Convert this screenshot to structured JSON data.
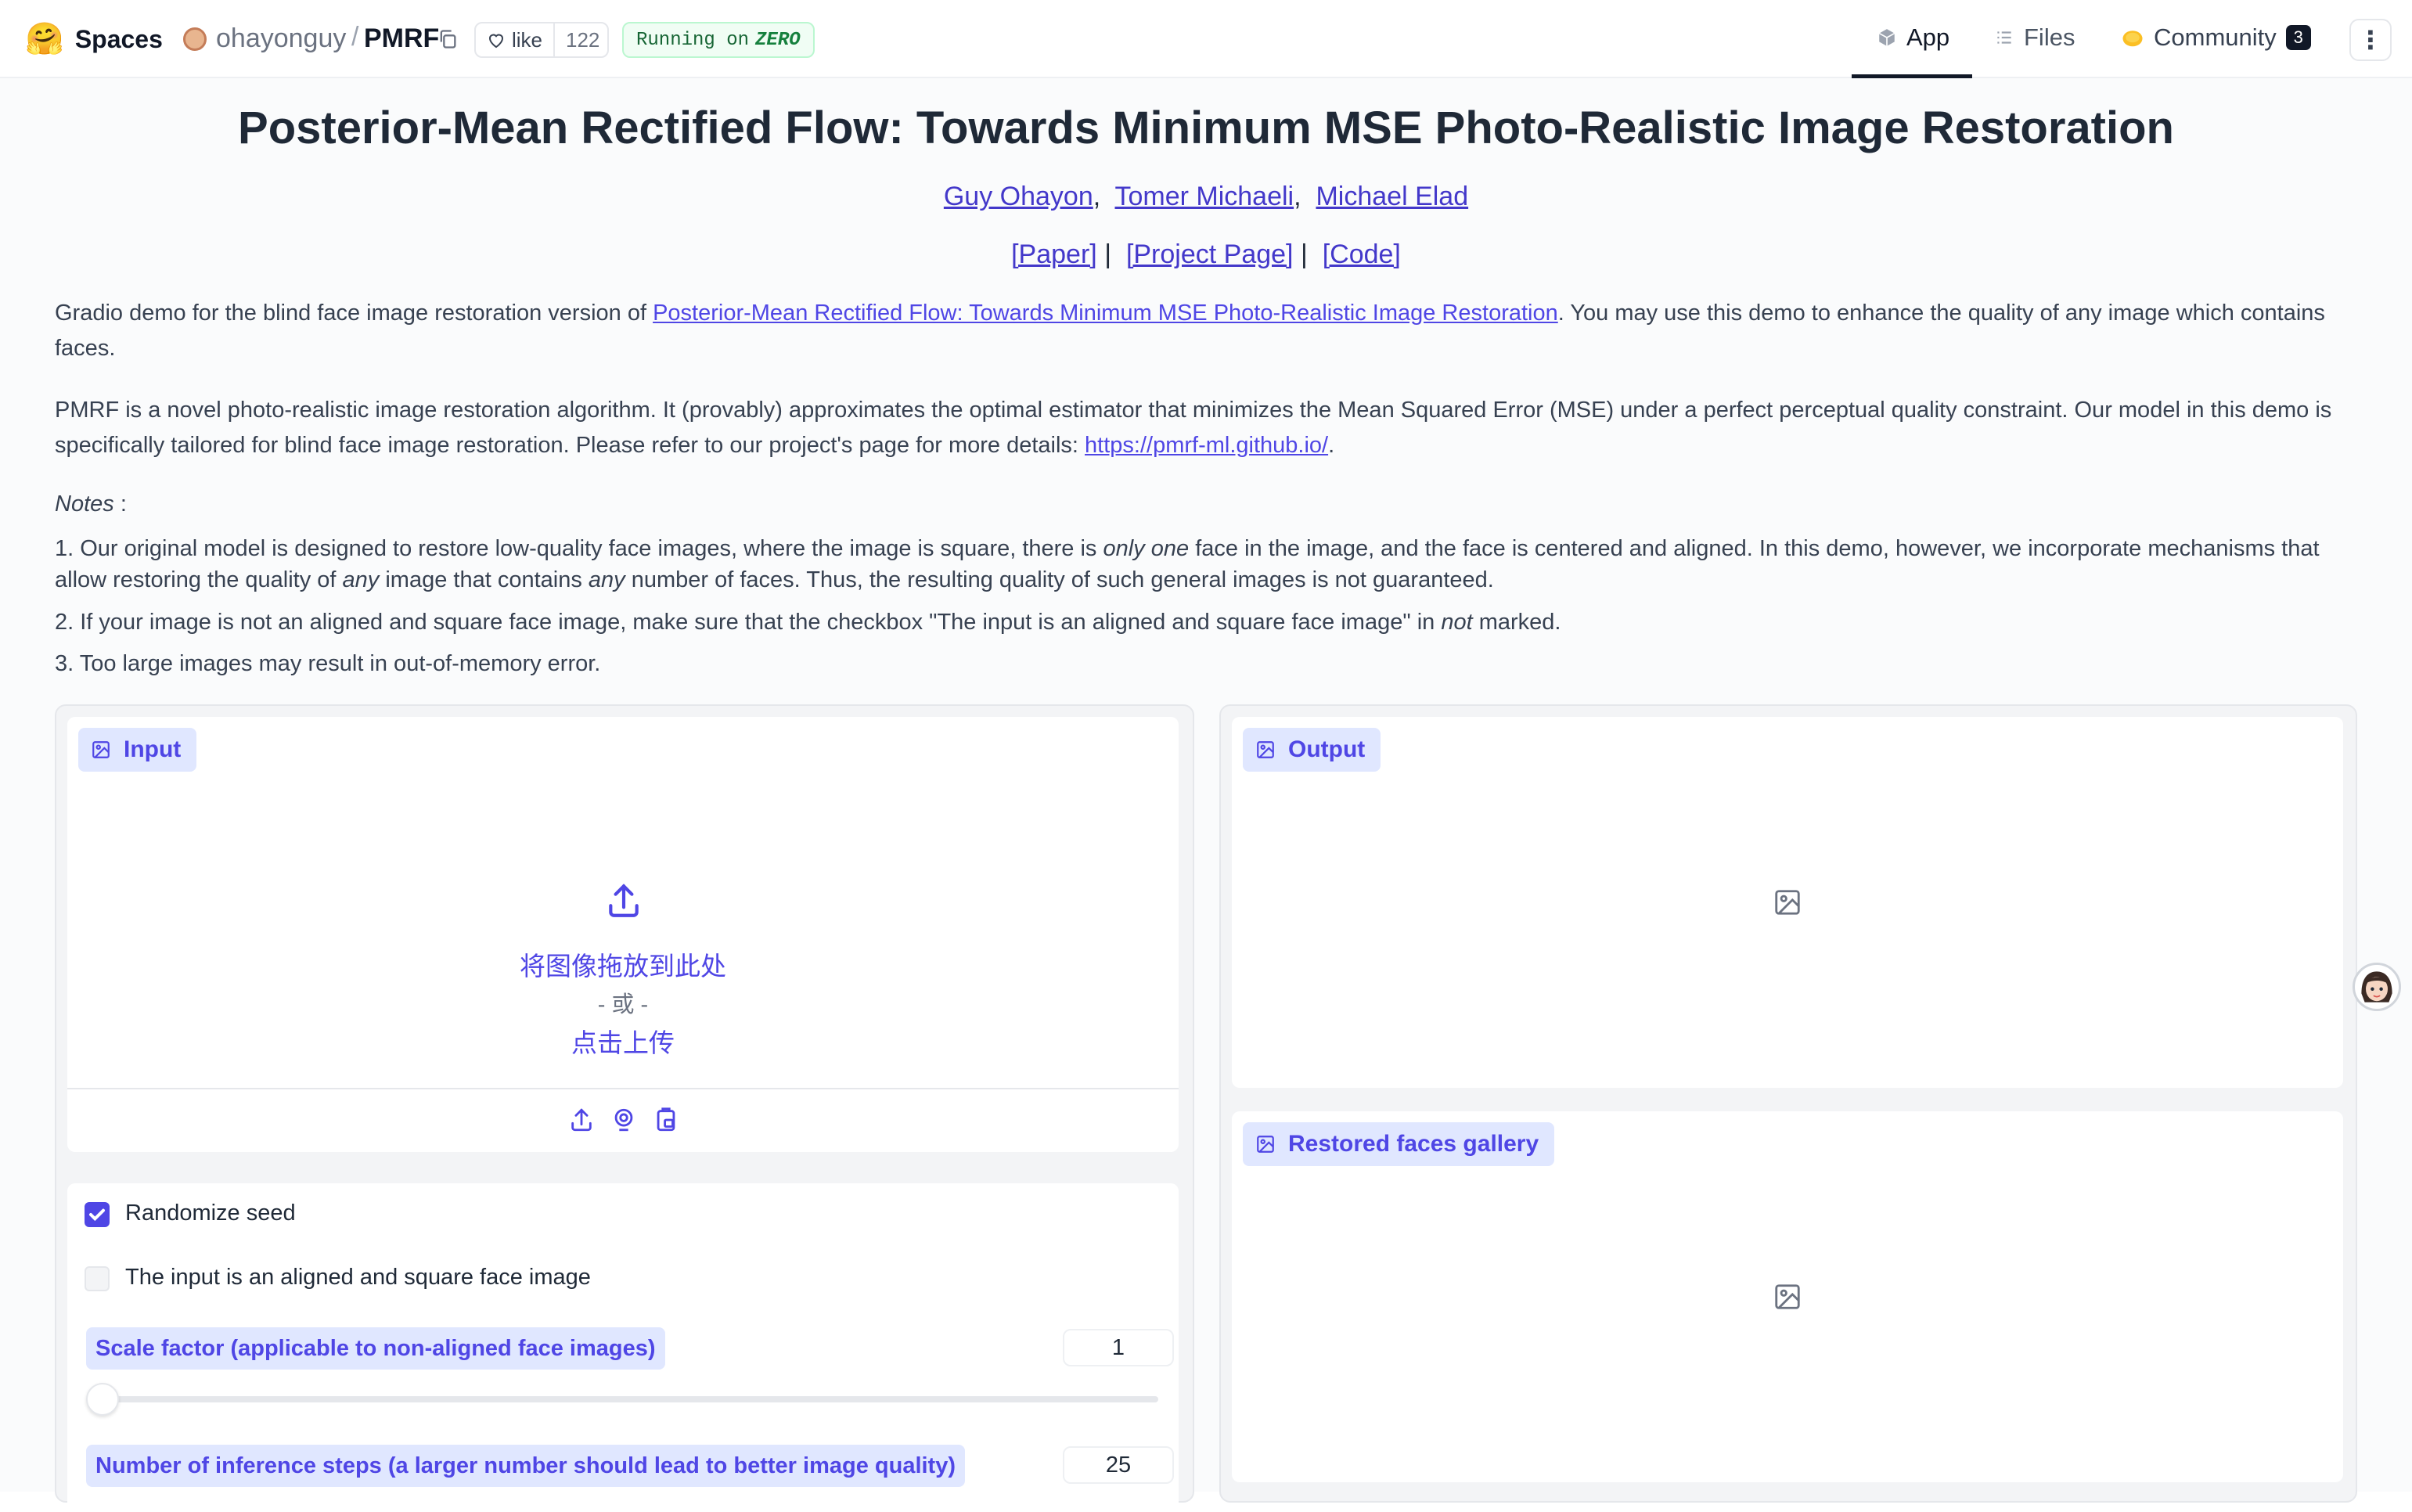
{
  "header": {
    "brand": "Spaces",
    "owner": "ohayonguy",
    "separator": "/",
    "repo": "PMRF",
    "like_label": "like",
    "like_count": "122",
    "running_prefix": "Running on",
    "running_hardware": "ZERO",
    "tabs": {
      "app": "App",
      "files": "Files",
      "community": "Community",
      "community_count": "3"
    }
  },
  "page": {
    "title": "Posterior-Mean Rectified Flow: Towards Minimum MSE Photo-Realistic Image Restoration",
    "authors": [
      "Guy Ohayon",
      "Tomer Michaeli",
      "Michael Elad"
    ],
    "author_separator": ",",
    "links": [
      "[Paper]",
      "[Project Page]",
      "[Code]"
    ],
    "link_separator": "|",
    "intro_before": "Gradio demo for the blind face image restoration version of ",
    "intro_link": "Posterior-Mean Rectified Flow: Towards Minimum MSE Photo-Realistic Image Restoration",
    "intro_after": ". You may use this demo to enhance the quality of any image which contains faces.",
    "desc_before": "PMRF is a novel photo-realistic image restoration algorithm. It (provably) approximates the optimal estimator that minimizes the Mean Squared Error (MSE) under a perfect perceptual quality constraint. Our model in this demo is specifically tailored for blind face image restoration. Please refer to our project's page for more details: ",
    "desc_link": "https://pmrf-ml.github.io/",
    "desc_after": ".",
    "notes_label": "Notes",
    "notes_colon": " :",
    "note1_a": "1. Our original model is designed to restore low-quality face images, where the image is square, there is ",
    "note1_b": "only one",
    "note1_c": " face in the image, and the face is centered and aligned. In this demo, however, we incorporate mechanisms that allow restoring the quality of ",
    "note1_d": "any",
    "note1_e": " image that contains ",
    "note1_f": "any",
    "note1_g": " number of faces. Thus, the resulting quality of such general images is not guaranteed.",
    "note2_a": "2. If your image is not an aligned and square face image, make sure that the checkbox \"The input is an aligned and square face image\" in ",
    "note2_b": "not",
    "note2_c": " marked.",
    "note3": "3. Too large images may result in out-of-memory error."
  },
  "input_panel": {
    "label": "Input",
    "drop_text": "将图像拖放到此处",
    "or_text": "- 或 -",
    "click_text": "点击上传",
    "source_icons": [
      "upload-icon",
      "webcam-icon",
      "clipboard-icon"
    ]
  },
  "controls": {
    "randomize_seed": {
      "label": "Randomize seed",
      "checked": true
    },
    "aligned_face": {
      "label": "The input is an aligned and square face image",
      "checked": false
    },
    "scale_factor": {
      "label": "Scale factor (applicable to non-aligned face images)",
      "value": "1",
      "fraction": 0
    },
    "inference_steps": {
      "label": "Number of inference steps (a larger number should lead to better image quality)",
      "value": "25"
    }
  },
  "output_panel": {
    "output_label": "Output",
    "gallery_label": "Restored faces gallery"
  },
  "colors": {
    "accent": "#4f46e5",
    "tag_bg": "#e0e7ff",
    "running_green": "#166534"
  }
}
